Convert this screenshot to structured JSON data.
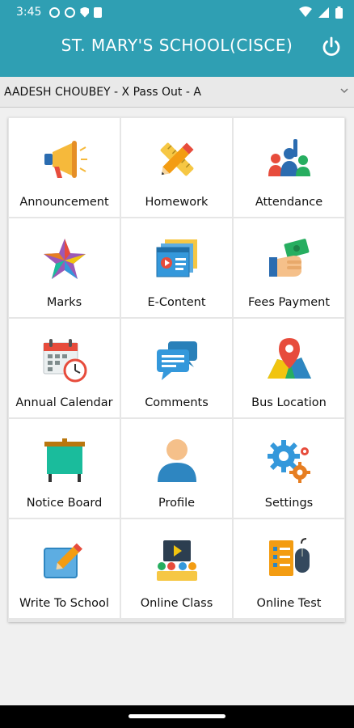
{
  "status_bar": {
    "time": "3:45"
  },
  "header": {
    "title": "ST. MARY'S SCHOOL(CISCE)"
  },
  "student_selector": {
    "selected": "AADESH CHOUBEY - X Pass Out - A"
  },
  "menu": {
    "items": [
      {
        "label": "Announcement",
        "icon": "megaphone-icon"
      },
      {
        "label": "Homework",
        "icon": "pencil-ruler-icon"
      },
      {
        "label": "Attendance",
        "icon": "raised-hands-icon"
      },
      {
        "label": "Marks",
        "icon": "star-icon"
      },
      {
        "label": "E-Content",
        "icon": "video-content-icon"
      },
      {
        "label": "Fees Payment",
        "icon": "cash-hand-icon"
      },
      {
        "label": "Annual Calendar",
        "icon": "calendar-clock-icon"
      },
      {
        "label": "Comments",
        "icon": "chat-bubbles-icon"
      },
      {
        "label": "Bus Location",
        "icon": "map-pin-icon"
      },
      {
        "label": "Notice Board",
        "icon": "easel-board-icon"
      },
      {
        "label": "Profile",
        "icon": "user-profile-icon"
      },
      {
        "label": "Settings",
        "icon": "gears-icon"
      },
      {
        "label": "Write To School",
        "icon": "write-note-icon"
      },
      {
        "label": "Online Class",
        "icon": "online-class-icon"
      },
      {
        "label": "Online Test",
        "icon": "test-mouse-icon"
      }
    ]
  },
  "colors": {
    "primary": "#2f9fb3"
  }
}
